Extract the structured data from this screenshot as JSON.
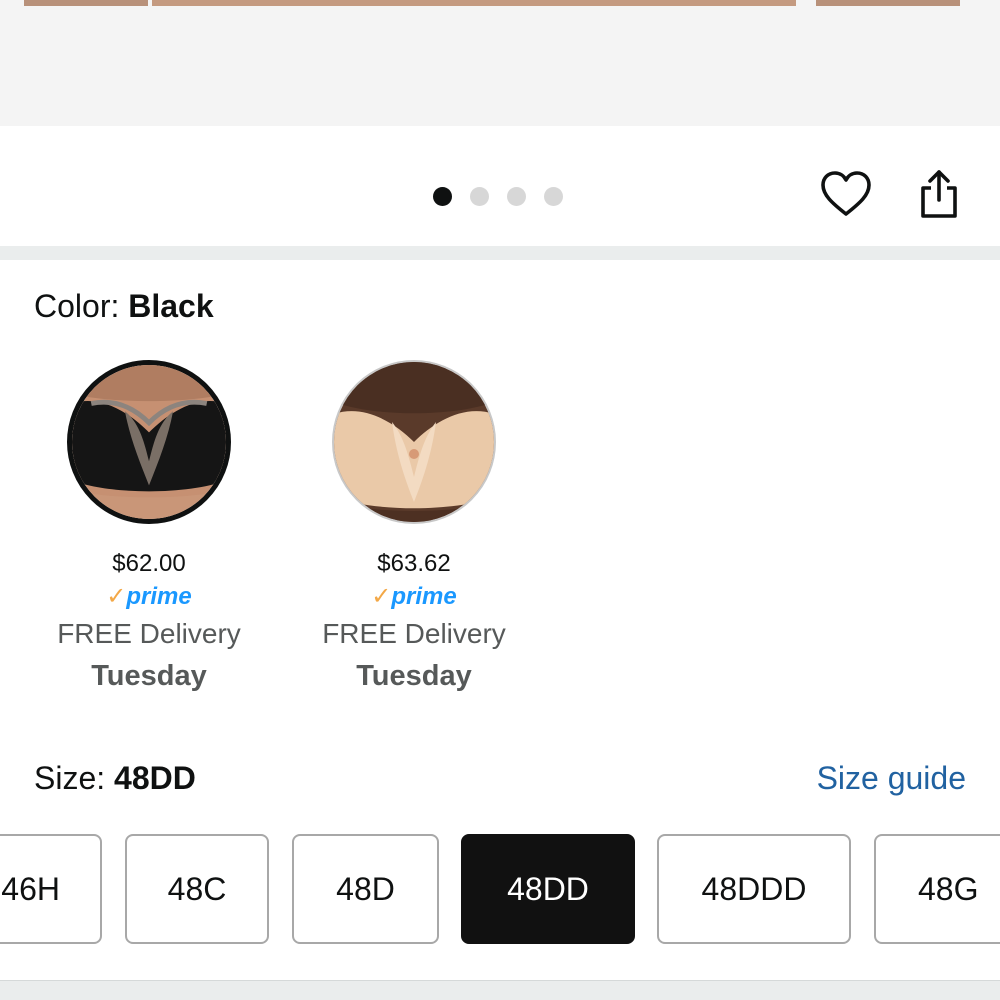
{
  "image_nav": {
    "dot_count": 4,
    "active_dot": 1,
    "heart_icon": "heart-outline-icon",
    "share_icon": "share-icon"
  },
  "color": {
    "label": "Color: ",
    "selected": "Black",
    "swatches": [
      {
        "price": "$62.00",
        "prime_check": "✓",
        "prime_word": "prime",
        "delivery": "FREE Delivery",
        "day": "Tuesday",
        "selected": true
      },
      {
        "price": "$63.62",
        "prime_check": "✓",
        "prime_word": "prime",
        "delivery": "FREE Delivery",
        "day": "Tuesday",
        "selected": false
      }
    ]
  },
  "size": {
    "label": "Size: ",
    "selected": "48DD",
    "guide_label": "Size guide",
    "options": [
      "46H",
      "48C",
      "48D",
      "48DD",
      "48DDD",
      "48G"
    ]
  },
  "colors": {
    "accent_link": "#2162a1",
    "prime_blue": "#1a98ff",
    "prime_check": "#f3a847",
    "selected_bg": "#111111"
  }
}
